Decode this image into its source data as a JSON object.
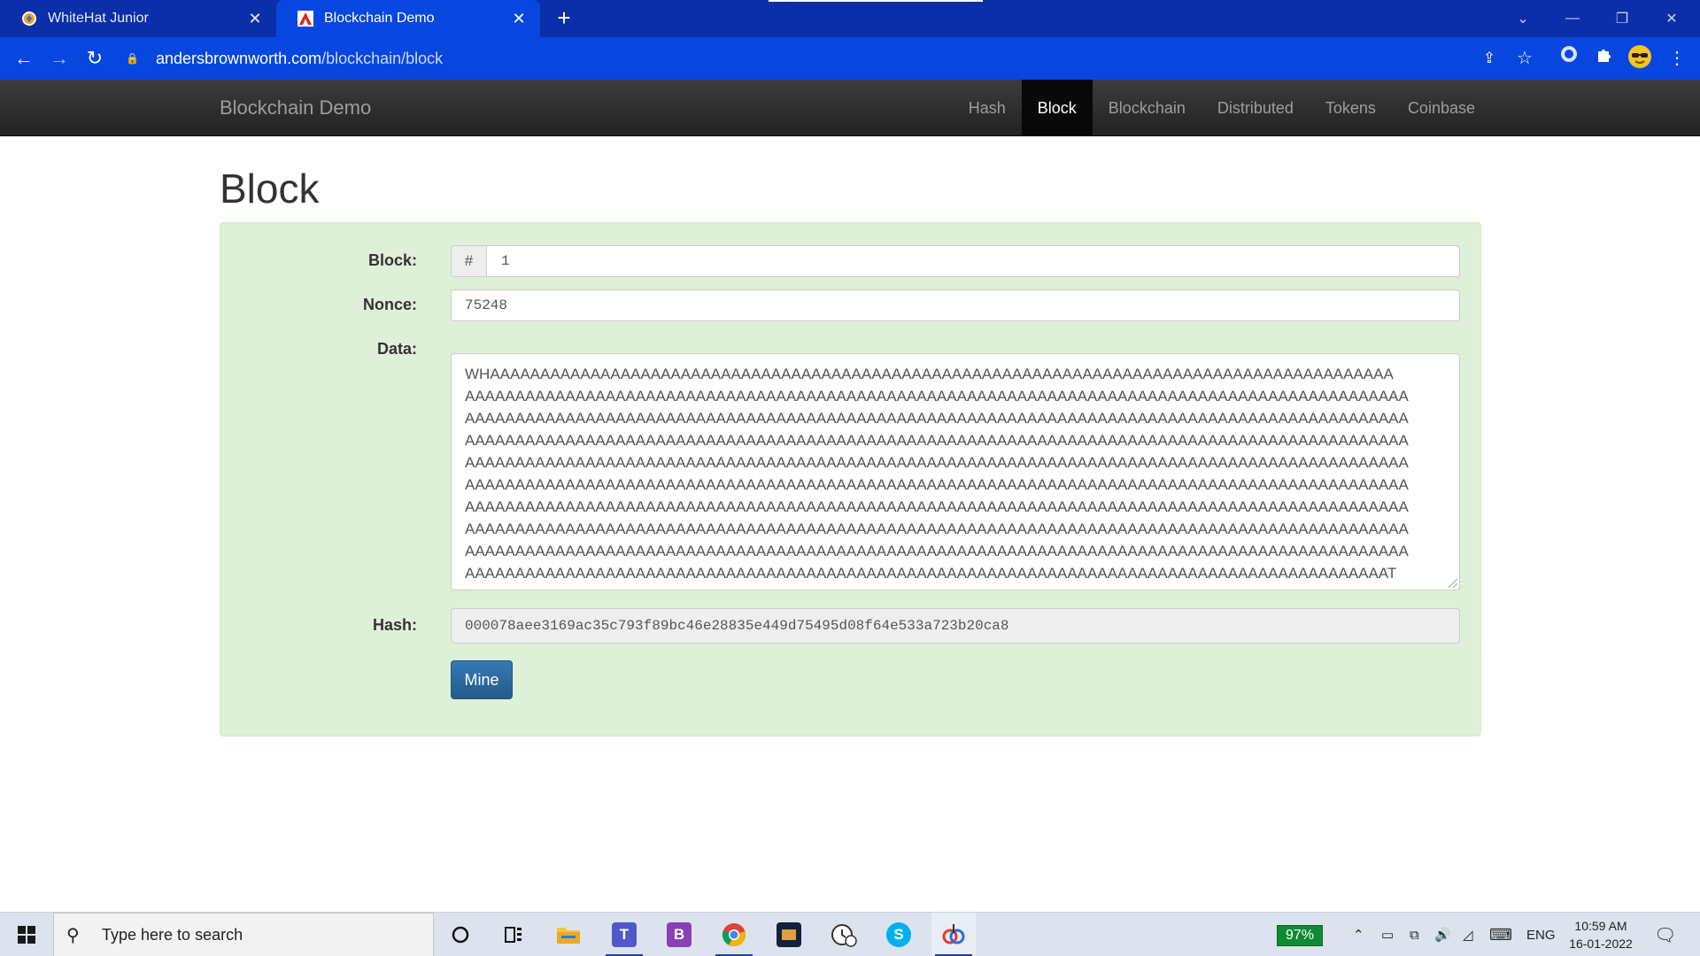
{
  "browser": {
    "tabs": [
      {
        "title": "WhiteHat Junior",
        "active": false
      },
      {
        "title": "Blockchain Demo",
        "active": true
      }
    ],
    "url_host": "andersbrownworth.com",
    "url_path": "/blockchain/block"
  },
  "site": {
    "brand": "Blockchain Demo",
    "nav": [
      "Hash",
      "Block",
      "Blockchain",
      "Distributed",
      "Tokens",
      "Coinbase"
    ],
    "active_nav": "Block"
  },
  "page": {
    "title": "Block",
    "block_label": "Block:",
    "block_prefix": "#",
    "block_value": "1",
    "nonce_label": "Nonce:",
    "nonce_value": "75248",
    "data_label": "Data:",
    "data_lines": [
      "WHAAAAAAAAAAAAAAAAAAAAAAAAAAAAAAAAAAAAAAAAAAAAAAAAAAAAAAAAAAAAAAAAAAAAAAAAAAAAAAAAAAAAAAAAAA",
      "AAAAAAAAAAAAAAAAAAAAAAAAAAAAAAAAAAAAAAAAAAAAAAAAAAAAAAAAAAAAAAAAAAAAAAAAAAAAAAAAAAAAAAAAAAAAAA",
      "AAAAAAAAAAAAAAAAAAAAAAAAAAAAAAAAAAAAAAAAAAAAAAAAAAAAAAAAAAAAAAAAAAAAAAAAAAAAAAAAAAAAAAAAAAAAAA",
      "AAAAAAAAAAAAAAAAAAAAAAAAAAAAAAAAAAAAAAAAAAAAAAAAAAAAAAAAAAAAAAAAAAAAAAAAAAAAAAAAAAAAAAAAAAAAAA",
      "AAAAAAAAAAAAAAAAAAAAAAAAAAAAAAAAAAAAAAAAAAAAAAAAAAAAAAAAAAAAAAAAAAAAAAAAAAAAAAAAAAAAAAAAAAAAAA",
      "AAAAAAAAAAAAAAAAAAAAAAAAAAAAAAAAAAAAAAAAAAAAAAAAAAAAAAAAAAAAAAAAAAAAAAAAAAAAAAAAAAAAAAAAAAAAAA",
      "AAAAAAAAAAAAAAAAAAAAAAAAAAAAAAAAAAAAAAAAAAAAAAAAAAAAAAAAAAAAAAAAAAAAAAAAAAAAAAAAAAAAAAAAAAAAAA",
      "AAAAAAAAAAAAAAAAAAAAAAAAAAAAAAAAAAAAAAAAAAAAAAAAAAAAAAAAAAAAAAAAAAAAAAAAAAAAAAAAAAAAAAAAAAAAAA",
      "AAAAAAAAAAAAAAAAAAAAAAAAAAAAAAAAAAAAAAAAAAAAAAAAAAAAAAAAAAAAAAAAAAAAAAAAAAAAAAAAAAAAAAAAAAAAAA",
      "AAAAAAAAAAAAAAAAAAAAAAAAAAAAAAAAAAAAAAAAAAAAAAAAAAAAAAAAAAAAAAAAAAAAAAAAAAAAAAAAAAAAAAAAAAAAT"
    ],
    "hash_label": "Hash:",
    "hash_value": "000078aee3169ac35c793f89bc46e28835e449d75495d08f64e533a723b20ca8",
    "mine_button": "Mine",
    "well_color": "#dff0d8"
  },
  "taskbar": {
    "search_placeholder": "Type here to search",
    "battery": "97%",
    "language": "ENG",
    "time": "10:59 AM",
    "date": "16-01-2022",
    "apps": [
      "cortana-icon",
      "task-view-icon",
      "file-explorer-icon",
      "teams-icon",
      "bootstrap-studio-icon",
      "chrome-icon",
      "video-app-icon",
      "alarm-clock-icon",
      "skype-icon",
      "paint-app-icon"
    ]
  }
}
